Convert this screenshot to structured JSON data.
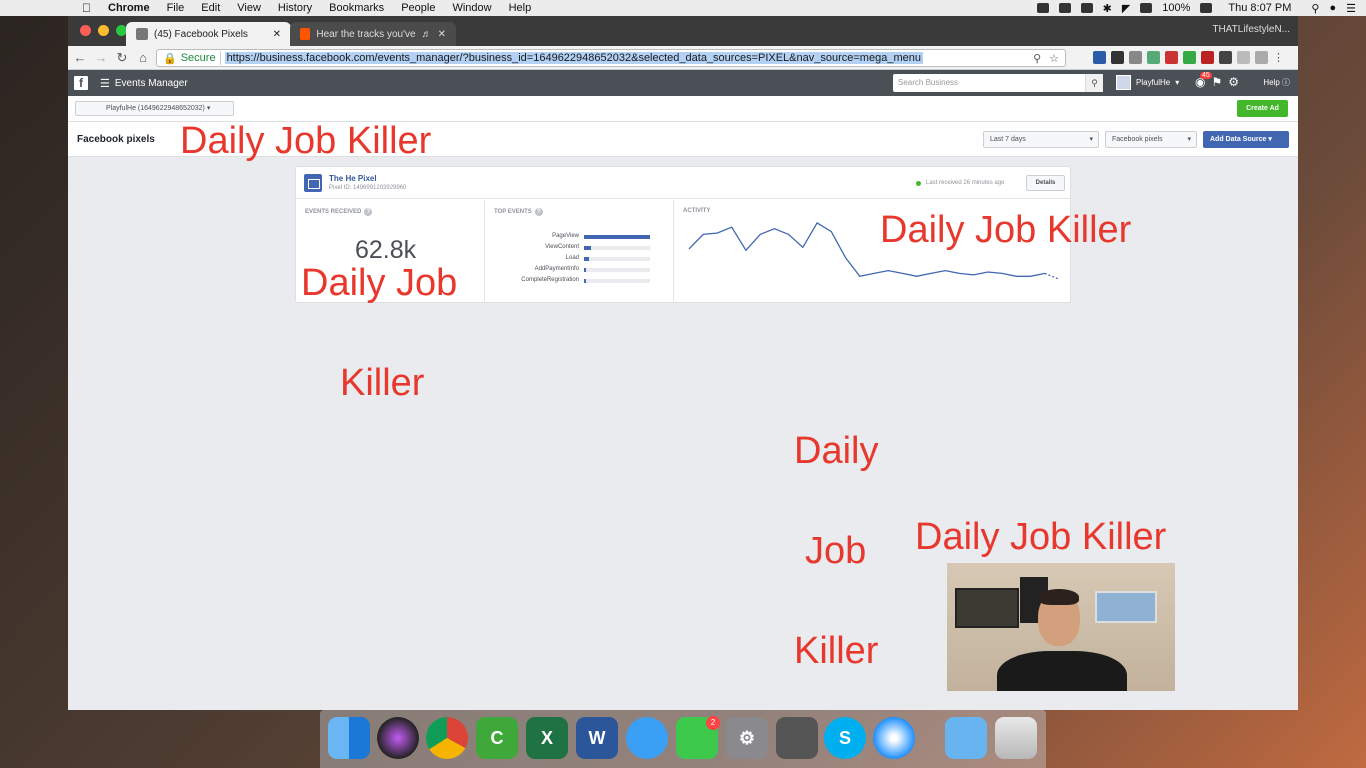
{
  "menubar": {
    "app": "Chrome",
    "items": [
      "File",
      "Edit",
      "View",
      "History",
      "Bookmarks",
      "People",
      "Window",
      "Help"
    ],
    "battery": "100%",
    "clock": "Thu 8:07 PM"
  },
  "browser": {
    "tabs": [
      {
        "label": "(45) Facebook Pixels"
      },
      {
        "label": "Hear the tracks you've liked"
      }
    ],
    "profile": "THATLifestyleN...",
    "secure_label": "Secure",
    "url": "https://business.facebook.com/events_manager/?business_id=1649622948652032&selected_data_sources=PIXEL&nav_source=mega_menu"
  },
  "fb": {
    "logo": "f",
    "app_title": "Events Manager",
    "search_placeholder": "Search Business",
    "user_name": "PlayfulHe",
    "notif_count": "45",
    "help": "Help",
    "account_select": "PlayfulHe (1649622948652032)",
    "create_ad": "Create Ad",
    "page_title": "Facebook pixels",
    "date_range": "Last 7 days",
    "source_filter": "Facebook pixels",
    "add_data_source": "Add Data Source"
  },
  "pixel_card": {
    "name": "The He Pixel",
    "pixel_id": "Pixel ID: 1496991203929960",
    "last_received": "Last received 26 minutes ago",
    "details": "Details",
    "events_received_label": "EVENTS RECEIVED",
    "events_received_value": "62.8k",
    "top_events_label": "TOP EVENTS",
    "activity_label": "ACTIVITY",
    "top_events": [
      {
        "name": "PageView",
        "share": 1.0
      },
      {
        "name": "ViewContent",
        "share": 0.1
      },
      {
        "name": "Load",
        "share": 0.07
      },
      {
        "name": "AddPaymentInfo",
        "share": 0.03
      },
      {
        "name": "CompleteRegistration",
        "share": 0.03
      }
    ],
    "activity_series": [
      50,
      60,
      61,
      65,
      49,
      60,
      64,
      60,
      51,
      68,
      62,
      44,
      31,
      33,
      35,
      33,
      31,
      33,
      35,
      33,
      32,
      34,
      33,
      31,
      31,
      33,
      29
    ],
    "activity_dashed_from": 25
  },
  "overlays": {
    "o1": "Daily Job Killer",
    "o2": "Daily Job Killer",
    "o3": "Daily Job",
    "o4": "Killer",
    "o5": "Daily",
    "o6": "Job",
    "o7": "Killer",
    "o8": "Daily Job Killer"
  },
  "dock": {
    "facetime_badge": "2",
    "apps": [
      "finder-icon",
      "siri-icon",
      "chrome-icon",
      "camtasia-icon",
      "excel-icon",
      "word-icon",
      "messages-icon",
      "facetime-icon",
      "system-preferences-icon",
      "photo-booth-icon",
      "skype-icon",
      "safari-icon",
      "folder-icon",
      "trash-icon"
    ]
  },
  "colors": {
    "fb_blue": "#4267b2",
    "overlay_red": "#e8372c",
    "green": "#42b72a"
  }
}
